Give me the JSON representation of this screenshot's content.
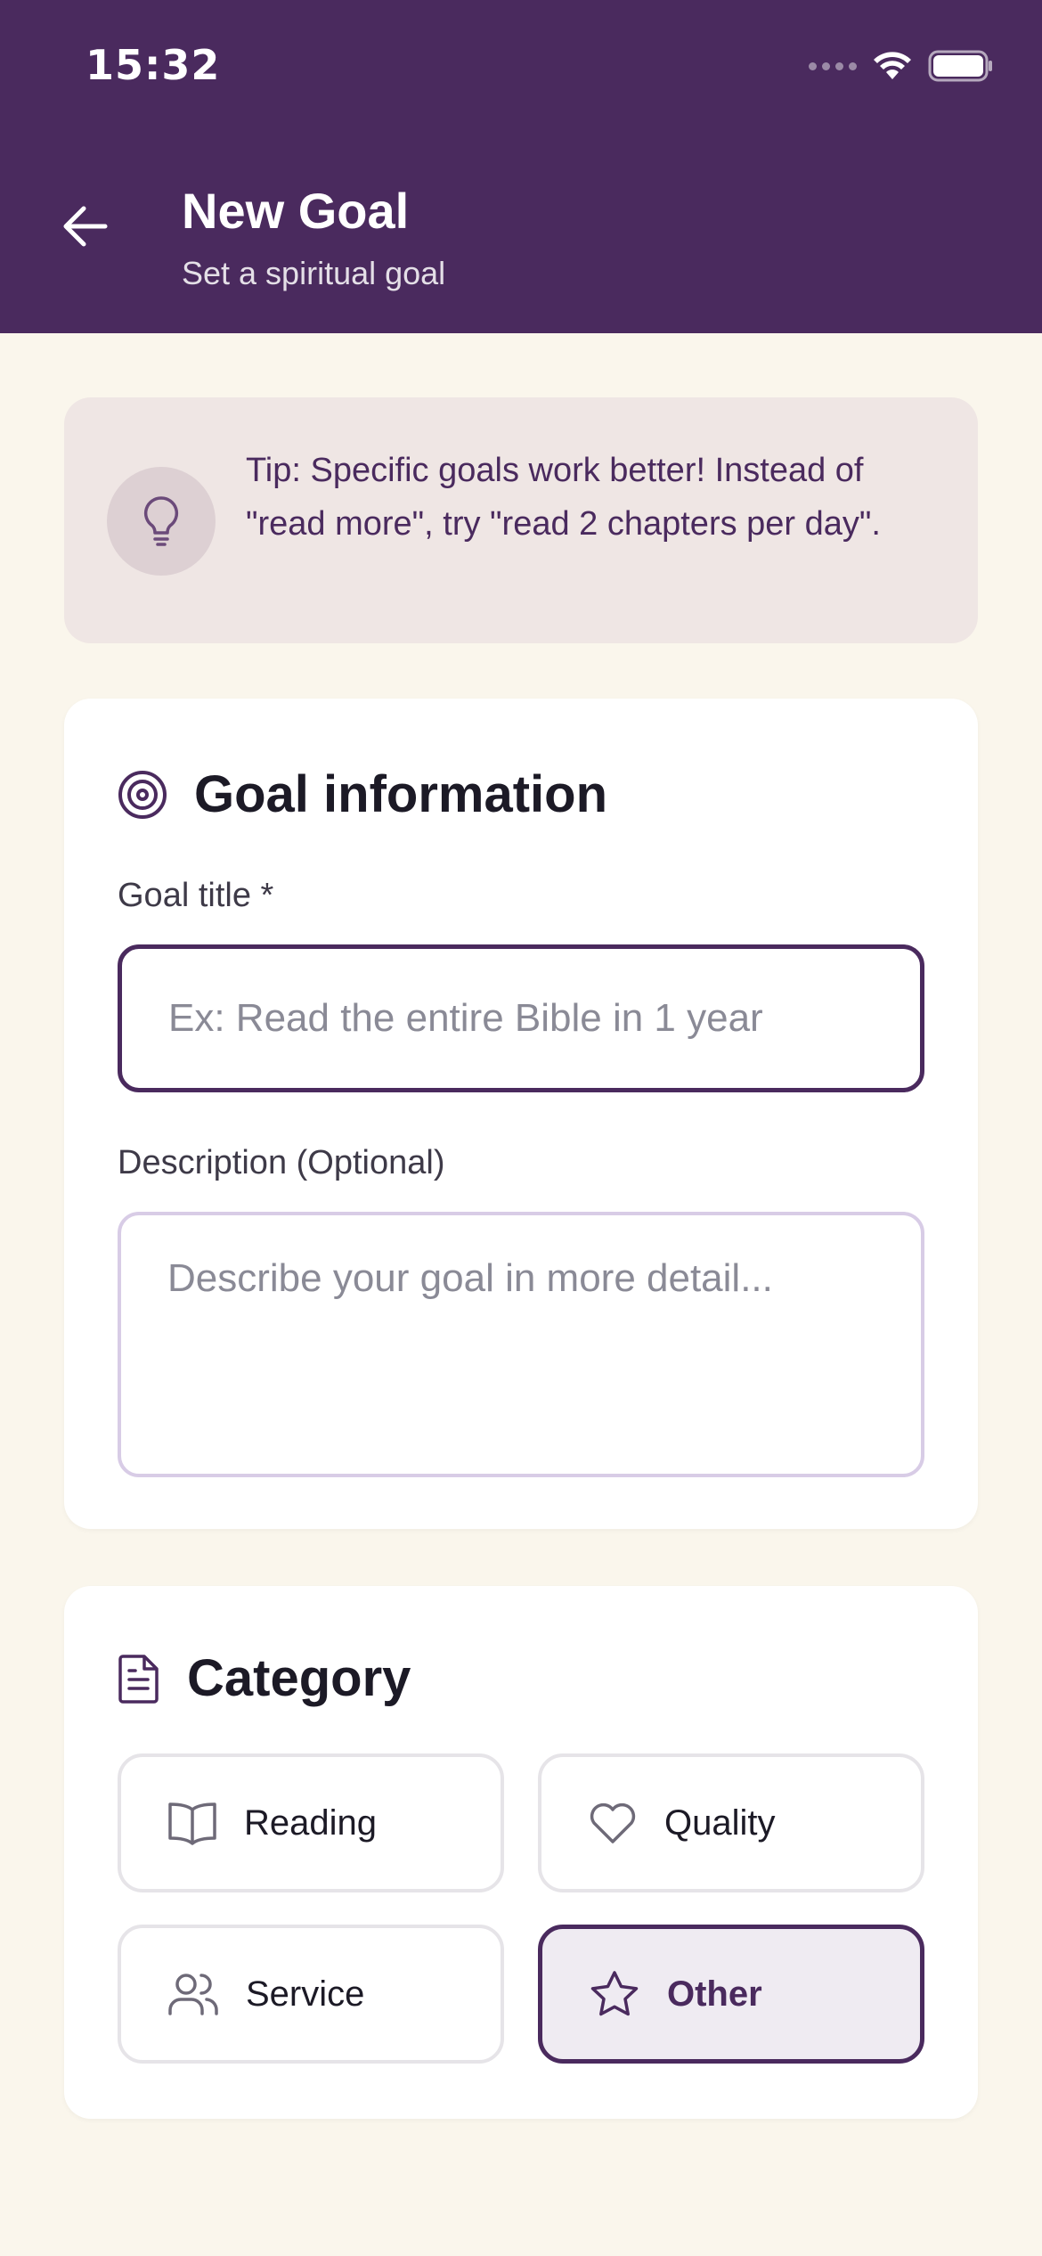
{
  "status_bar": {
    "time": "15:32"
  },
  "header": {
    "title": "New Goal",
    "subtitle": "Set a spiritual goal"
  },
  "tip": {
    "text": "Tip: Specific goals work better! Instead of \"read more\", try \"read 2 chapters per day\"."
  },
  "goal_info": {
    "heading": "Goal information",
    "title_label": "Goal title *",
    "title_placeholder": "Ex: Read the entire Bible in 1 year",
    "description_label": "Description (Optional)",
    "description_placeholder": "Describe your goal in more detail..."
  },
  "category": {
    "heading": "Category",
    "options": [
      {
        "label": "Reading",
        "icon": "book-icon",
        "selected": false
      },
      {
        "label": "Quality",
        "icon": "heart-icon",
        "selected": false
      },
      {
        "label": "Service",
        "icon": "users-icon",
        "selected": false
      },
      {
        "label": "Other",
        "icon": "star-icon",
        "selected": true
      }
    ]
  },
  "colors": {
    "primary": "#4a2a5e",
    "background": "#faf6ec",
    "tip_background": "#efe6e4",
    "card": "#ffffff"
  }
}
